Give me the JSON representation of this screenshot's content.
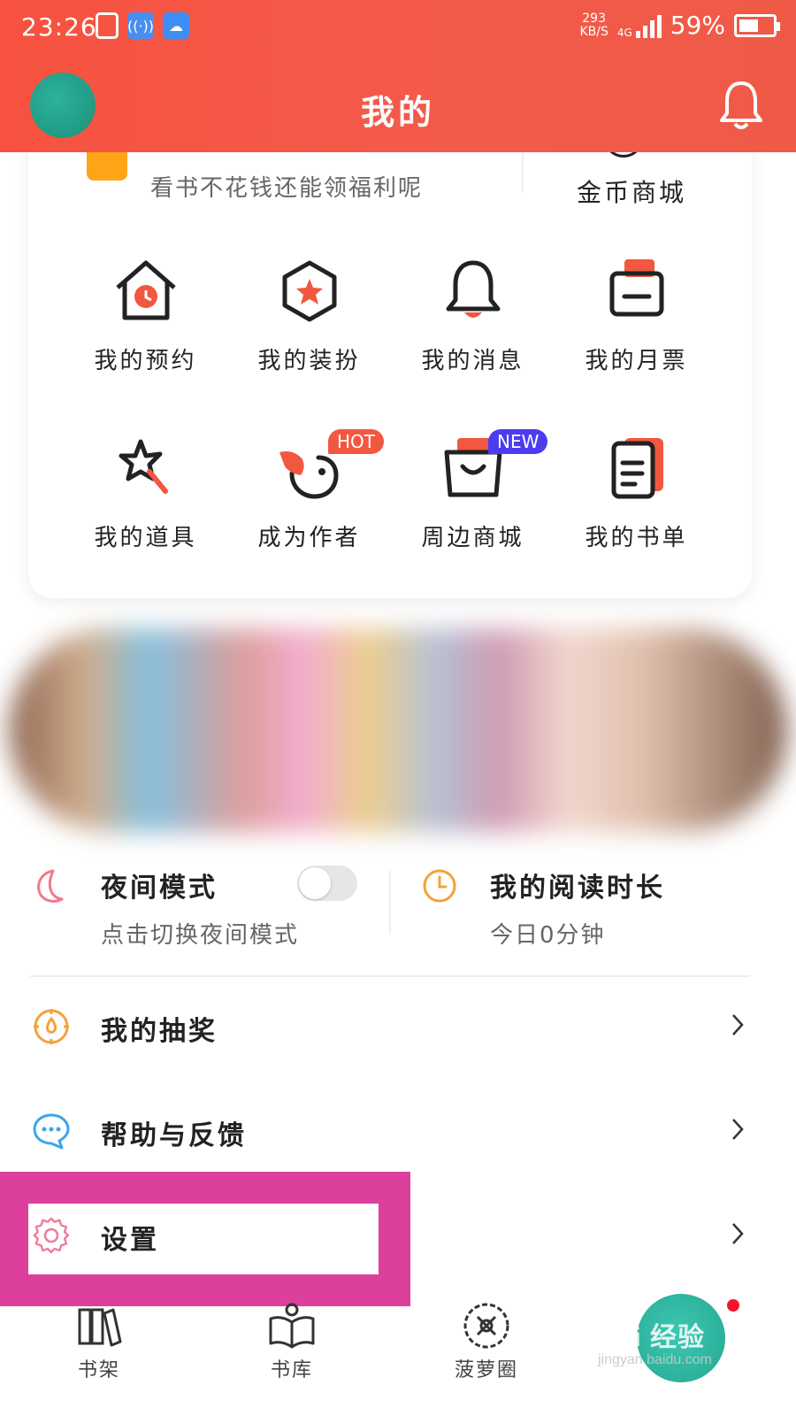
{
  "status_bar": {
    "time": "23:26",
    "net_speed_value": "293",
    "net_speed_unit": "KB/S",
    "network_type": "4G",
    "battery_percent": "59%",
    "battery_level": 0.59
  },
  "header": {
    "title": "我的",
    "accent_color": "#f35a4a"
  },
  "welfare": {
    "subtitle": "看书不花钱还能领福利呢",
    "coin_shop_label": "金币商城"
  },
  "grid": {
    "items": [
      {
        "label": "我的预约",
        "icon": "house-clock-icon"
      },
      {
        "label": "我的装扮",
        "icon": "hexagon-star-icon"
      },
      {
        "label": "我的消息",
        "icon": "bell-icon"
      },
      {
        "label": "我的月票",
        "icon": "ticket-icon"
      },
      {
        "label": "我的道具",
        "icon": "magic-wand-icon"
      },
      {
        "label": "成为作者",
        "icon": "bird-quill-icon",
        "badge": "HOT"
      },
      {
        "label": "周边商城",
        "icon": "shopping-bag-icon",
        "badge": "NEW"
      },
      {
        "label": "我的书单",
        "icon": "book-list-icon"
      }
    ]
  },
  "night_mode": {
    "title": "夜间模式",
    "subtitle": "点击切换夜间模式",
    "enabled": false
  },
  "reading_time": {
    "title": "我的阅读时长",
    "subtitle": "今日0分钟"
  },
  "menu": {
    "items": [
      {
        "label": "我的抽奖",
        "icon": "lottery-icon"
      },
      {
        "label": "帮助与反馈",
        "icon": "chat-bubble-icon"
      },
      {
        "label": "设置",
        "icon": "gear-icon"
      }
    ]
  },
  "bottom_nav": {
    "items": [
      {
        "label": "书架",
        "icon": "bookshelf-icon"
      },
      {
        "label": "书库",
        "icon": "book-library-icon"
      },
      {
        "label": "菠萝圈",
        "icon": "pineapple-circle-icon"
      }
    ]
  },
  "watermark": {
    "text": "Bai 经验",
    "url": "jingyan.baidu.com"
  }
}
